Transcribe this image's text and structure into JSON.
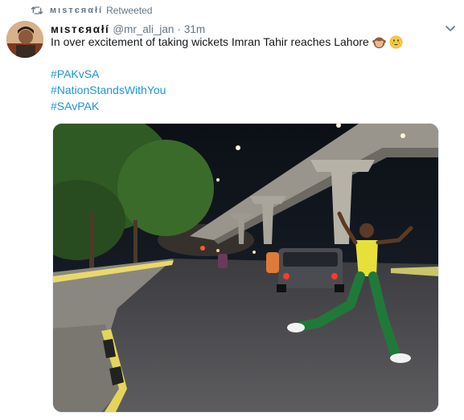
{
  "retweet": {
    "icon": "retweet-icon",
    "retweeter_name": "мιѕтєяαłí",
    "label": "Retweeted"
  },
  "tweet": {
    "display_name": "мιѕтєяαłí",
    "handle": "@mr_ali_jan",
    "separator": "·",
    "time": "31m",
    "text": "In over excitement of taking wickets Imran Tahir reaches Lahore",
    "emojis": [
      "see-no-evil-monkey-emoji",
      "grinning-face-emoji"
    ],
    "hashtags": [
      "#PAKvSA",
      "#NationStandsWithYou",
      "#SAvPAK"
    ],
    "link_color": "#1b95e0",
    "muted_color": "#657786"
  },
  "icons": {
    "caret": "chevron-down-icon"
  }
}
